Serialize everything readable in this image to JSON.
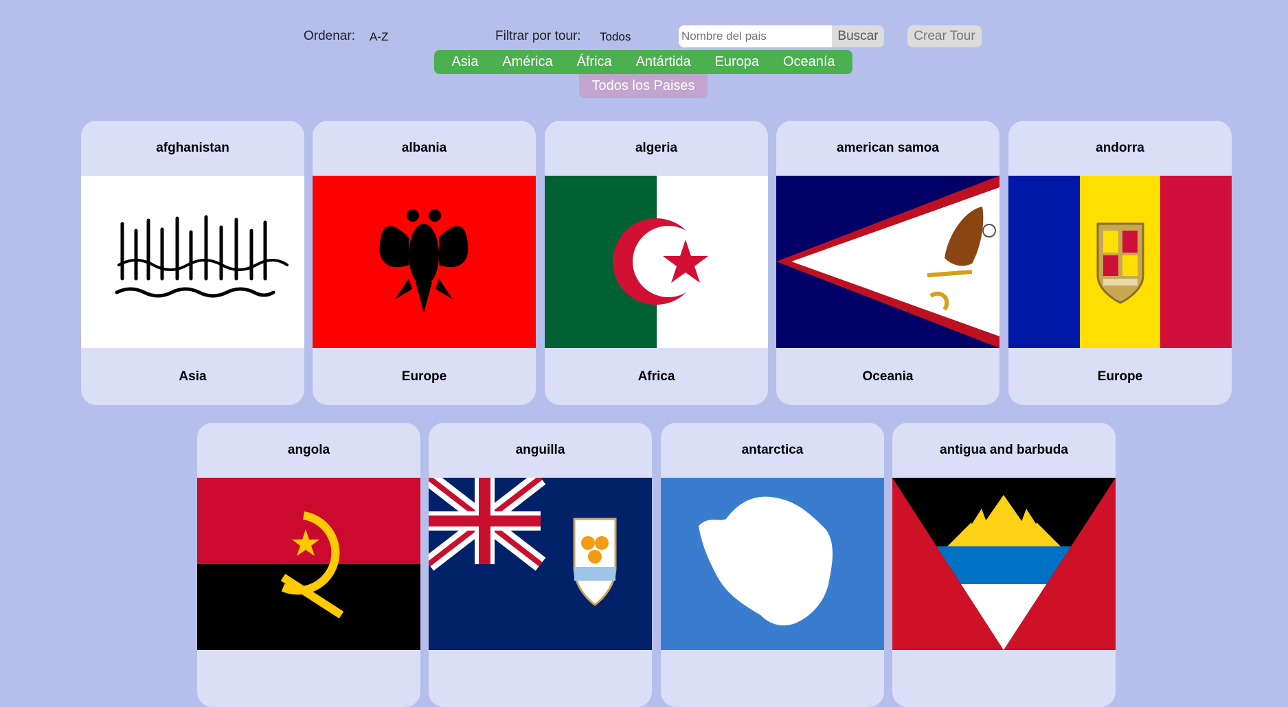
{
  "controls": {
    "sort_label": "Ordenar:",
    "sort_value": "A-Z",
    "filter_label": "Filtrar por tour:",
    "filter_value": "Todos",
    "search_placeholder": "Nombre del pais",
    "search_button": "Buscar",
    "create_tour": "Crear Tour"
  },
  "continents": [
    "Asia",
    "América",
    "África",
    "Antártida",
    "Europa",
    "Oceanía"
  ],
  "all_countries": "Todos los Paises",
  "countries": [
    {
      "name": "afghanistan",
      "continent": "Asia",
      "flag": "afghanistan-flag"
    },
    {
      "name": "albania",
      "continent": "Europe",
      "flag": "albania-flag"
    },
    {
      "name": "algeria",
      "continent": "Africa",
      "flag": "algeria-flag"
    },
    {
      "name": "american samoa",
      "continent": "Oceania",
      "flag": "american-samoa-flag"
    },
    {
      "name": "andorra",
      "continent": "Europe",
      "flag": "andorra-flag"
    },
    {
      "name": "angola",
      "continent": "",
      "flag": "angola-flag"
    },
    {
      "name": "anguilla",
      "continent": "",
      "flag": "anguilla-flag"
    },
    {
      "name": "antarctica",
      "continent": "",
      "flag": "antarctica-flag"
    },
    {
      "name": "antigua and barbuda",
      "continent": "",
      "flag": "antigua-and-barbuda-flag"
    }
  ],
  "colors": {
    "background": "#b6bfeb",
    "card": "#dadef6",
    "continent_bar": "#4caf50",
    "all_button": "#c3a4cf"
  }
}
